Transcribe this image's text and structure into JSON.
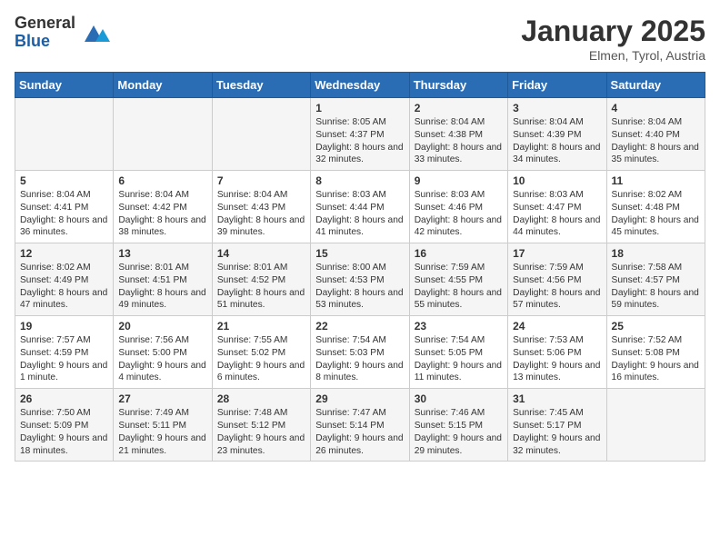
{
  "header": {
    "logo_general": "General",
    "logo_blue": "Blue",
    "month": "January 2025",
    "location": "Elmen, Tyrol, Austria"
  },
  "days_of_week": [
    "Sunday",
    "Monday",
    "Tuesday",
    "Wednesday",
    "Thursday",
    "Friday",
    "Saturday"
  ],
  "weeks": [
    [
      {
        "day": "",
        "info": ""
      },
      {
        "day": "",
        "info": ""
      },
      {
        "day": "",
        "info": ""
      },
      {
        "day": "1",
        "info": "Sunrise: 8:05 AM\nSunset: 4:37 PM\nDaylight: 8 hours and 32 minutes."
      },
      {
        "day": "2",
        "info": "Sunrise: 8:04 AM\nSunset: 4:38 PM\nDaylight: 8 hours and 33 minutes."
      },
      {
        "day": "3",
        "info": "Sunrise: 8:04 AM\nSunset: 4:39 PM\nDaylight: 8 hours and 34 minutes."
      },
      {
        "day": "4",
        "info": "Sunrise: 8:04 AM\nSunset: 4:40 PM\nDaylight: 8 hours and 35 minutes."
      }
    ],
    [
      {
        "day": "5",
        "info": "Sunrise: 8:04 AM\nSunset: 4:41 PM\nDaylight: 8 hours and 36 minutes."
      },
      {
        "day": "6",
        "info": "Sunrise: 8:04 AM\nSunset: 4:42 PM\nDaylight: 8 hours and 38 minutes."
      },
      {
        "day": "7",
        "info": "Sunrise: 8:04 AM\nSunset: 4:43 PM\nDaylight: 8 hours and 39 minutes."
      },
      {
        "day": "8",
        "info": "Sunrise: 8:03 AM\nSunset: 4:44 PM\nDaylight: 8 hours and 41 minutes."
      },
      {
        "day": "9",
        "info": "Sunrise: 8:03 AM\nSunset: 4:46 PM\nDaylight: 8 hours and 42 minutes."
      },
      {
        "day": "10",
        "info": "Sunrise: 8:03 AM\nSunset: 4:47 PM\nDaylight: 8 hours and 44 minutes."
      },
      {
        "day": "11",
        "info": "Sunrise: 8:02 AM\nSunset: 4:48 PM\nDaylight: 8 hours and 45 minutes."
      }
    ],
    [
      {
        "day": "12",
        "info": "Sunrise: 8:02 AM\nSunset: 4:49 PM\nDaylight: 8 hours and 47 minutes."
      },
      {
        "day": "13",
        "info": "Sunrise: 8:01 AM\nSunset: 4:51 PM\nDaylight: 8 hours and 49 minutes."
      },
      {
        "day": "14",
        "info": "Sunrise: 8:01 AM\nSunset: 4:52 PM\nDaylight: 8 hours and 51 minutes."
      },
      {
        "day": "15",
        "info": "Sunrise: 8:00 AM\nSunset: 4:53 PM\nDaylight: 8 hours and 53 minutes."
      },
      {
        "day": "16",
        "info": "Sunrise: 7:59 AM\nSunset: 4:55 PM\nDaylight: 8 hours and 55 minutes."
      },
      {
        "day": "17",
        "info": "Sunrise: 7:59 AM\nSunset: 4:56 PM\nDaylight: 8 hours and 57 minutes."
      },
      {
        "day": "18",
        "info": "Sunrise: 7:58 AM\nSunset: 4:57 PM\nDaylight: 8 hours and 59 minutes."
      }
    ],
    [
      {
        "day": "19",
        "info": "Sunrise: 7:57 AM\nSunset: 4:59 PM\nDaylight: 9 hours and 1 minute."
      },
      {
        "day": "20",
        "info": "Sunrise: 7:56 AM\nSunset: 5:00 PM\nDaylight: 9 hours and 4 minutes."
      },
      {
        "day": "21",
        "info": "Sunrise: 7:55 AM\nSunset: 5:02 PM\nDaylight: 9 hours and 6 minutes."
      },
      {
        "day": "22",
        "info": "Sunrise: 7:54 AM\nSunset: 5:03 PM\nDaylight: 9 hours and 8 minutes."
      },
      {
        "day": "23",
        "info": "Sunrise: 7:54 AM\nSunset: 5:05 PM\nDaylight: 9 hours and 11 minutes."
      },
      {
        "day": "24",
        "info": "Sunrise: 7:53 AM\nSunset: 5:06 PM\nDaylight: 9 hours and 13 minutes."
      },
      {
        "day": "25",
        "info": "Sunrise: 7:52 AM\nSunset: 5:08 PM\nDaylight: 9 hours and 16 minutes."
      }
    ],
    [
      {
        "day": "26",
        "info": "Sunrise: 7:50 AM\nSunset: 5:09 PM\nDaylight: 9 hours and 18 minutes."
      },
      {
        "day": "27",
        "info": "Sunrise: 7:49 AM\nSunset: 5:11 PM\nDaylight: 9 hours and 21 minutes."
      },
      {
        "day": "28",
        "info": "Sunrise: 7:48 AM\nSunset: 5:12 PM\nDaylight: 9 hours and 23 minutes."
      },
      {
        "day": "29",
        "info": "Sunrise: 7:47 AM\nSunset: 5:14 PM\nDaylight: 9 hours and 26 minutes."
      },
      {
        "day": "30",
        "info": "Sunrise: 7:46 AM\nSunset: 5:15 PM\nDaylight: 9 hours and 29 minutes."
      },
      {
        "day": "31",
        "info": "Sunrise: 7:45 AM\nSunset: 5:17 PM\nDaylight: 9 hours and 32 minutes."
      },
      {
        "day": "",
        "info": ""
      }
    ]
  ]
}
